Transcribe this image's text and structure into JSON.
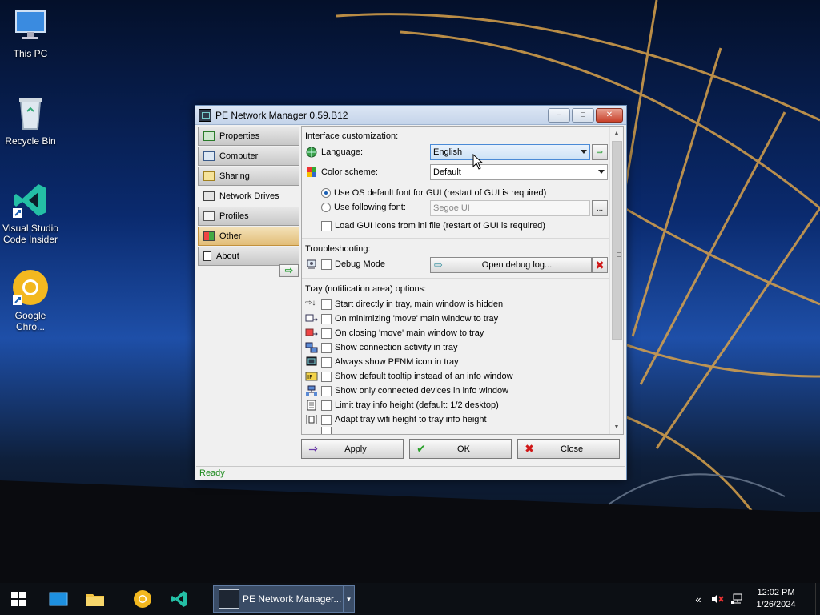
{
  "desktop": {
    "icons": [
      {
        "label": "This PC",
        "icon": "monitor-icon"
      },
      {
        "label": "Recycle Bin",
        "icon": "recycle-bin-icon"
      },
      {
        "label": "Visual Studio Code Insider",
        "icon": "vscode-insiders-icon"
      },
      {
        "label": "Google Chro...",
        "icon": "chrome-canary-icon"
      }
    ]
  },
  "window": {
    "title": "PE Network Manager 0.59.B12",
    "controls": {
      "minimize": "minimize-icon",
      "maximize": "maximize-icon",
      "close": "close-icon"
    }
  },
  "sidebar": {
    "items": [
      {
        "label": "Properties",
        "icon": "properties-icon"
      },
      {
        "label": "Computer",
        "icon": "computer-icon"
      },
      {
        "label": "Sharing",
        "icon": "sharing-icon"
      },
      {
        "label": "Network Drives",
        "icon": "network-drives-icon",
        "state": "active"
      },
      {
        "label": "Profiles",
        "icon": "profiles-icon"
      },
      {
        "label": "Other",
        "icon": "other-icon",
        "state": "hover"
      },
      {
        "label": "About",
        "icon": "about-icon"
      }
    ]
  },
  "interface": {
    "section_title": "Interface customization:",
    "language_label": "Language:",
    "language_value": "English",
    "color_scheme_label": "Color scheme:",
    "color_scheme_value": "Default",
    "font_default_label": "Use OS default font for GUI (restart of GUI is required)",
    "font_following_label": "Use following font:",
    "font_value": "Segoe UI",
    "font_browse": "...",
    "load_icons_label": "Load GUI icons from ini file (restart of GUI is required)"
  },
  "troubleshooting": {
    "section_title": "Troubleshooting:",
    "debug_label": "Debug Mode",
    "open_log_label": "Open debug log..."
  },
  "tray": {
    "section_title": "Tray (notification area) options:",
    "options": [
      "Start directly in tray, main window is hidden",
      "On minimizing 'move' main window to tray",
      "On closing 'move' main window to tray",
      "Show connection activity in tray",
      "Always show PENM icon in tray",
      "Show default tooltip instead of an info window",
      "Show only connected devices in info window",
      "Limit tray info height (default: 1/2 desktop)",
      "Adapt tray wifi height to tray info height"
    ]
  },
  "buttons": {
    "apply": "Apply",
    "ok": "OK",
    "close": "Close"
  },
  "status": "Ready",
  "taskbar": {
    "app_label": "PE Network Manager...",
    "time": "12:02 PM",
    "date": "1/26/2024"
  },
  "colors": {
    "status_green": "#1c8a1c",
    "hover_orange": "#e2bd78",
    "focus_blue": "#4a8ad6"
  }
}
